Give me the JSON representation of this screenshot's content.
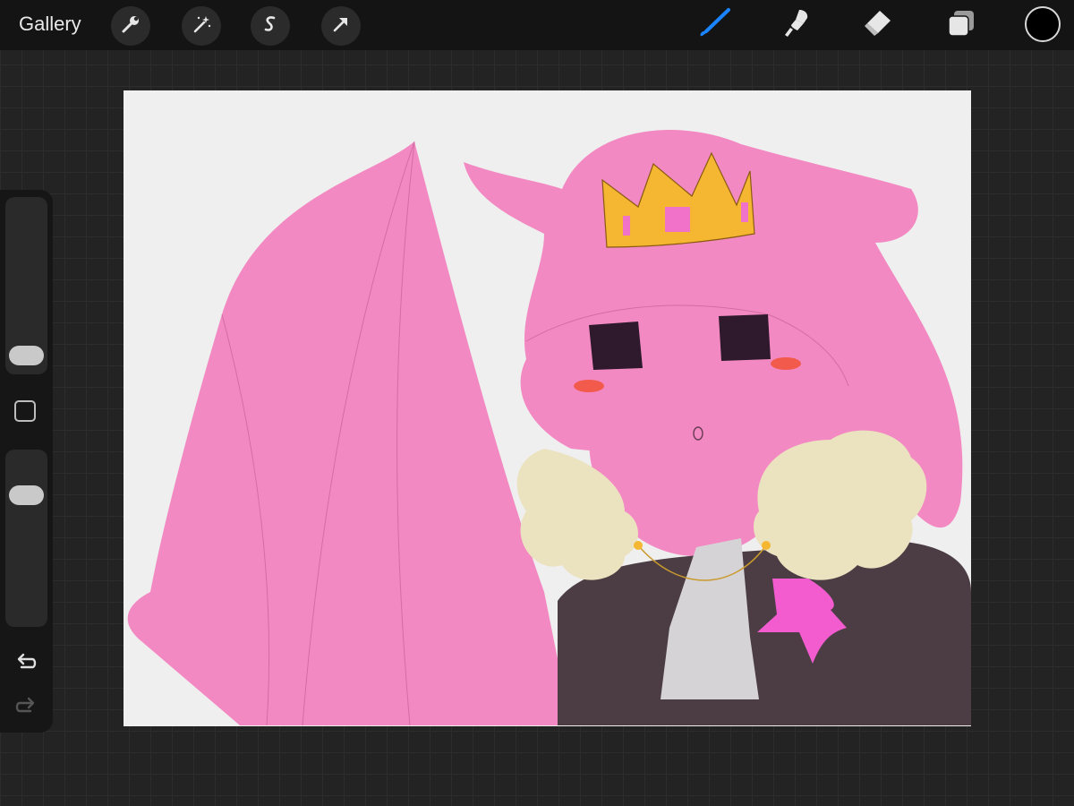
{
  "topbar": {
    "gallery_label": "Gallery",
    "left_tools": [
      "wrench-icon",
      "magic-wand-icon",
      "selection-icon",
      "transform-arrow-icon"
    ],
    "right_tools": [
      "brush-icon",
      "smudge-icon",
      "eraser-icon",
      "layers-icon"
    ],
    "active_tool": "brush-icon",
    "accent_color": "#1a84ff",
    "current_color": "#000000"
  },
  "sidebar": {
    "controls": [
      "brush-size-slider",
      "modify-button",
      "opacity-slider",
      "undo-icon",
      "redo-icon"
    ]
  },
  "canvas": {
    "background_color": "#efefef",
    "colors": {
      "skin": "#f389c2",
      "crown": "#f5b731",
      "crown_gem": "#f072c9",
      "eyes": "#2e1a2c",
      "blush": "#f25a4c",
      "fur": "#ebe2bf",
      "coat": "#4b3d43",
      "cravat": "#d6d3d6",
      "brooch": "#f25ccf"
    }
  }
}
